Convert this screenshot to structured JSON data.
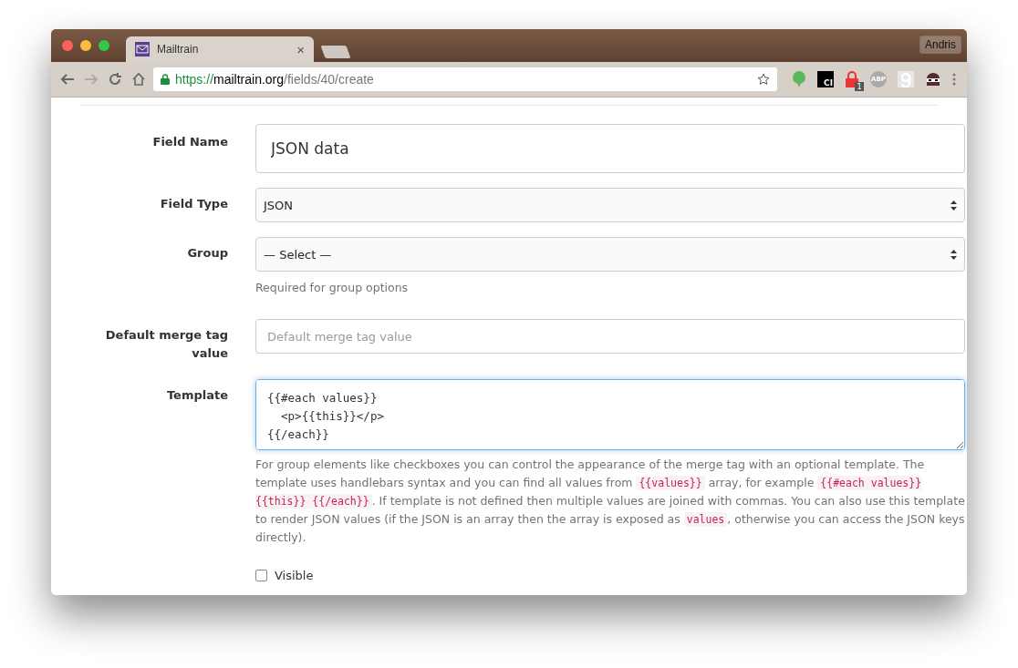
{
  "browser": {
    "tab": {
      "title": "Mailtrain",
      "close": "×"
    },
    "profile": "Andris",
    "url": {
      "scheme": "https://",
      "host": "mailtrain.org",
      "path": "/fields/40/create"
    },
    "extensions": [
      {
        "kind": "bubble"
      },
      {
        "kind": "label",
        "text": "CI"
      },
      {
        "kind": "lock",
        "badge": "1"
      },
      {
        "kind": "abp",
        "text": "ABP"
      },
      {
        "kind": "gplus"
      },
      {
        "kind": "mask"
      }
    ]
  },
  "form": {
    "fields": [
      {
        "kind": "input",
        "label": "Field Name",
        "value": "JSON data",
        "large": true
      },
      {
        "kind": "select",
        "label": "Field Type",
        "value": "JSON"
      },
      {
        "kind": "select",
        "label": "Group",
        "value": "— Select —",
        "help": "Required for group options"
      },
      {
        "kind": "input",
        "label": "Default merge tag value",
        "placeholder": "Default merge tag value",
        "large": false
      },
      {
        "kind": "textarea",
        "label": "Template",
        "value": "{{#each values}}\n  <p>{{this}}</p>\n{{/each}}",
        "focused": true,
        "help_segments": [
          {
            "kind": "text",
            "text": "For group elements like checkboxes you can control the appearance of the merge tag with an optional template. The template uses handlebars syntax and you can find all values from "
          },
          {
            "kind": "code",
            "text": "{{values}}"
          },
          {
            "kind": "text",
            "text": " array, for example "
          },
          {
            "kind": "code",
            "text": "{{#each values}} {{this}} {{/each}}"
          },
          {
            "kind": "text",
            "text": ". If template is not defined then multiple values are joined with commas. You can also use this template to render JSON values (if the JSON is an array then the array is exposed as "
          },
          {
            "kind": "code",
            "text": "values"
          },
          {
            "kind": "text",
            "text": ", otherwise you can access the JSON keys directly)."
          }
        ]
      },
      {
        "kind": "checkbox",
        "label": "Visible",
        "checked": false
      }
    ]
  }
}
